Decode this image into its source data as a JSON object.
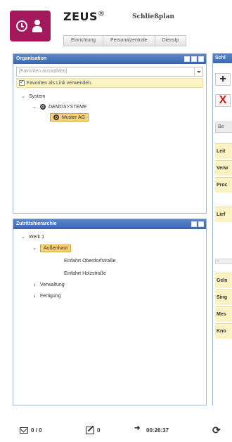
{
  "header": {
    "brand": "ZEUS",
    "brand_mark": "®",
    "module": "Schließplan",
    "tabs": [
      "Einrichtung",
      "Personalzentrale",
      "Dienstp"
    ]
  },
  "org_panel": {
    "title": "Organisation",
    "favorites_placeholder": "[Favoriten auswählen]",
    "fav_link_label": "Favoriten als Link verwenden.",
    "tree": {
      "system": "System",
      "demosysteme": "DEMOSYSTEME",
      "muster": "Muster AG"
    }
  },
  "sub_panel": {
    "title": "Zutrittshierarchie",
    "tree": {
      "werk": "Werk 1",
      "aussenhaut": "Außenhaut",
      "einfahrt1": "Einfahrt Oberdorfstraße",
      "einfahrt2": "Einfahrt Holzstraße",
      "verwaltung": "Verwaltung",
      "fertigung": "Fertigung"
    }
  },
  "right_panel": {
    "title": "Schl",
    "plus": "+",
    "remove": "X",
    "column": "Be",
    "rows_top": [
      "Leit",
      "Verw",
      "Proc",
      "Lief"
    ],
    "rows_bottom": [
      "Geln",
      "Sing",
      "Mes",
      "Kno"
    ]
  },
  "status": {
    "messages": "0 / 0",
    "edits": "0",
    "session_time": "00:26:37"
  }
}
